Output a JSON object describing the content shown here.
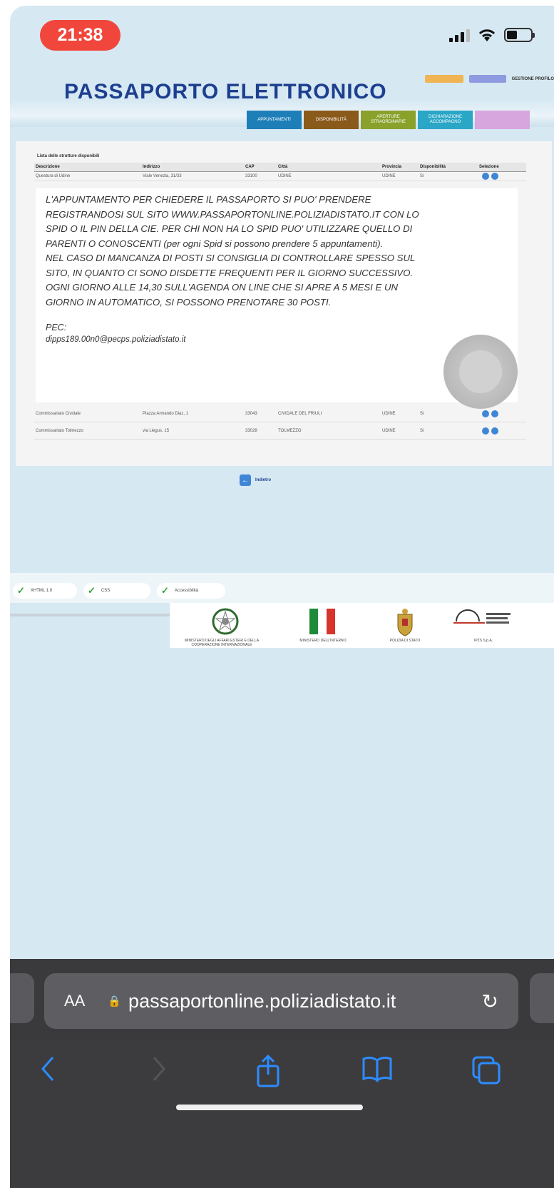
{
  "status": {
    "time": "21:38"
  },
  "site": {
    "title": "PASSAPORTO ELETTRONICO",
    "top_links": [
      "",
      "",
      "GESTIONE PROFILO"
    ],
    "nav_tabs": [
      {
        "label": "APPUNTAMENTI",
        "color": "#1e7fb8"
      },
      {
        "label": "DISPONIBILITÀ",
        "color": "#8a5a1b"
      },
      {
        "label": "APERTURE STRAORDINARIE",
        "color": "#8aa12b"
      },
      {
        "label": "DICHIARAZIONE ACCOMPAGNO",
        "color": "#2aa6c7"
      },
      {
        "label": "",
        "color": "#d7a6de"
      }
    ]
  },
  "list": {
    "caption": "Lista delle strutture disponibili",
    "headers": [
      "Descrizione",
      "Indirizzo",
      "CAP",
      "Città",
      "Provincia",
      "Disponibilità",
      "Selezione"
    ],
    "first_row": [
      "Questura di Udine",
      "Viale Venezia, 31/33",
      "33100",
      "UDINE",
      "UDINE",
      "Si"
    ],
    "rows": [
      [
        "Commissariato Cividale",
        "Piazza Armando Diaz, 1",
        "33043",
        "CIVIDALE DEL FRIULI",
        "UDINE",
        "Si"
      ],
      [
        "Commissariato Tolmezzo",
        "via Liegus, 15",
        "33028",
        "TOLMEZZO",
        "UDINE",
        "Si"
      ]
    ]
  },
  "info": {
    "text": "L'APPUNTAMENTO PER CHIEDERE IL PASSAPORTO SI PUO' PRENDERE\nREGISTRANDOSI SUL SITO WWW.PASSAPORTONLINE.POLIZIADISTATO.IT CON LO\nSPID O IL PIN DELLA CIE. PER CHI NON HA LO SPID PUO' UTILIZZARE QUELLO DI\nPARENTI O CONOSCENTI (per ogni Spid si possono prendere 5 appuntamenti).\nNEL CASO DI MANCANZA DI POSTI SI CONSIGLIA DI CONTROLLARE SPESSO SUL\nSITO, IN QUANTO CI SONO DISDETTE FREQUENTI PER IL GIORNO SUCCESSIVO.\nOGNI GIORNO ALLE 14,30 SULL'AGENDA ON LINE CHE SI APRE A 5 MESI E UN\nGIORNO IN AUTOMATICO, SI POSSONO PRENOTARE 30 POSTI.",
    "pec_label": "PEC:",
    "pec_value": "dipps189.00n0@pecps.poliziadistato.it"
  },
  "back_label": "Indietro",
  "footer": {
    "badges": [
      "XHTML 1.0",
      "CSS",
      "Accessibilità"
    ],
    "logos": [
      {
        "label": "MINISTERO DEGLI AFFARI ESTERI E DELLA COOPERAZIONE INTERNAZIONALE",
        "icon": "italian-emblem-icon"
      },
      {
        "label": "MINISTERO DELL'INTERNO",
        "icon": "italian-flag-icon"
      },
      {
        "label": "POLIZIA DI STATO",
        "icon": "police-crest-icon"
      },
      {
        "label": "IPZS S.p.A.",
        "icon": "ipzs-logo-icon"
      }
    ]
  },
  "browser": {
    "aa_label": "AA",
    "url": "passaportonline.poliziadistato.it"
  }
}
